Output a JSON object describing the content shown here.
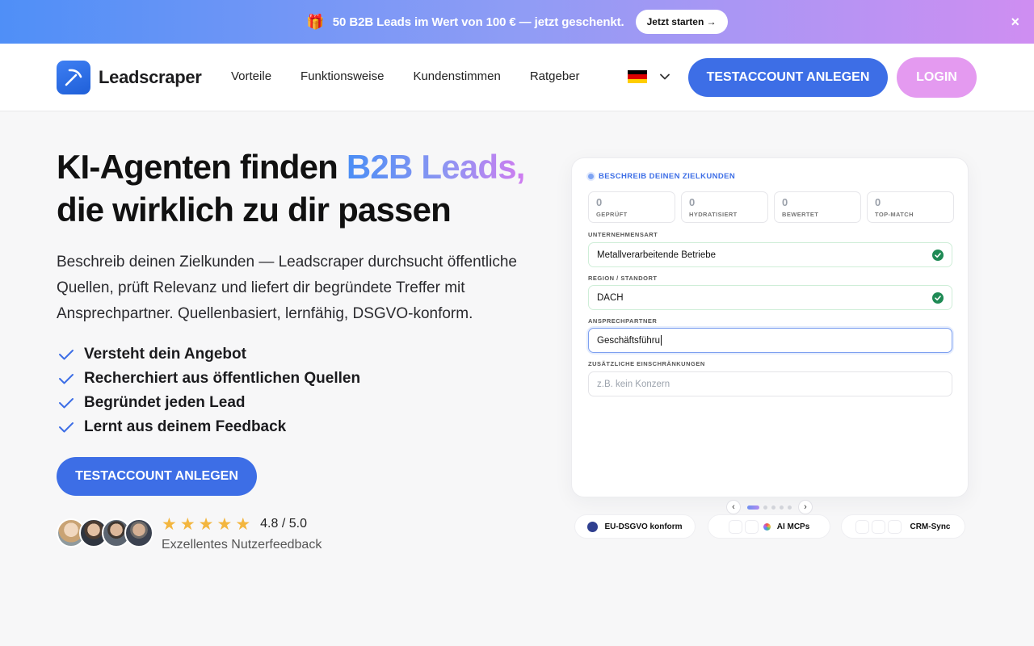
{
  "promo": {
    "icon": "gift-icon",
    "text": "50 B2B Leads im Wert von 100 € — jetzt geschenkt.",
    "button": "Jetzt starten →",
    "close": "×"
  },
  "header": {
    "logo_text": "Leadscraper",
    "nav": [
      "Vorteile",
      "Funktionsweise",
      "Kundenstimmen",
      "Ratgeber"
    ],
    "language": "de",
    "trial_button": "TESTACCOUNT ANLEGEN",
    "login_button": "LOGIN"
  },
  "hero": {
    "title_part1": "KI-Agenten finden ",
    "title_highlight": "B2B Leads,",
    "title_line2": "die wirklich zu dir passen",
    "lead": "Beschreib deinen Zielkunden — Leadscraper durchsucht öffentliche Quellen, prüft Relevanz und liefert dir begründete Treffer mit Ansprechpartner. Quellenbasiert, lernfähig, DSGVO-konform.",
    "checks": [
      "Versteht dein Angebot",
      "Recherchiert aus öffentlichen Quellen",
      "Begründet jeden Lead",
      "Lernt aus deinem Feedback"
    ],
    "cta": "TESTACCOUNT ANLEGEN",
    "rating_score": "4.8 / 5.0",
    "rating_stars": 5,
    "rating_label": "Exzellentes Nutzerfeedback"
  },
  "panel": {
    "title": "BESCHREIB DEINEN ZIELKUNDEN",
    "stats": [
      {
        "value": "0",
        "label": "GEPRÜFT"
      },
      {
        "value": "0",
        "label": "HYDRATISIERT"
      },
      {
        "value": "0",
        "label": "BEWERTET"
      },
      {
        "value": "0",
        "label": "TOP-MATCH"
      }
    ],
    "fields": [
      {
        "label": "UNTERNEHMENSART",
        "value": "Metallverarbeitende Betriebe",
        "valid": true
      },
      {
        "label": "REGION / STANDORT",
        "value": "DACH",
        "valid": true
      },
      {
        "label": "ANSPRECHPARTNER",
        "value": "Geschäftsführu",
        "active": true
      },
      {
        "label": "ZUSÄTZLICHE EINSCHRÄNKUNGEN",
        "value": "",
        "placeholder": "z.B. kein Konzern"
      }
    ]
  },
  "carousel": {
    "prev": "‹",
    "next": "›",
    "slides": 5,
    "active_slide": 1
  },
  "badges": {
    "gdpr": "EU-DSGVO konform",
    "ai": "AI MCPs",
    "crm": "CRM-Sync"
  },
  "colors": {
    "primary": "#3d6ee6",
    "login": "#e49af0",
    "success": "#1f8a55",
    "star": "#f3b63f"
  }
}
